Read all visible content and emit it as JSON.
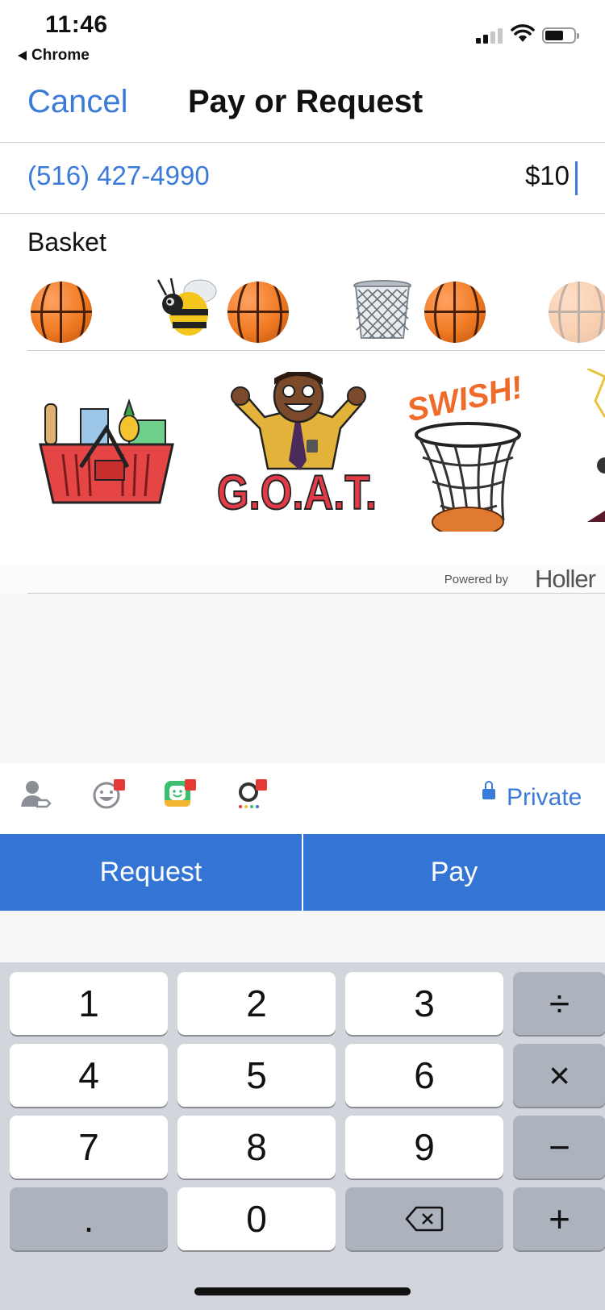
{
  "status_bar": {
    "time": "11:46",
    "back_app": "Chrome"
  },
  "nav": {
    "cancel_label": "Cancel",
    "title": "Pay or Request"
  },
  "recipient": {
    "phone": "(516) 427-4990"
  },
  "amount": "$10",
  "note": {
    "text": "Basket"
  },
  "emoji_suggestions": [
    "basketball-icon",
    "bee-icon",
    "basketball-icon",
    "wastebasket-icon",
    "basketball-icon",
    "basketball-icon"
  ],
  "gifs": [
    {
      "name": "grocery-basket-sticker"
    },
    {
      "name": "goat-sticker",
      "text": "G.O.A.T."
    },
    {
      "name": "swish-sticker",
      "text": "SWISH!"
    }
  ],
  "powered_by": {
    "label": "Powered by",
    "brand": "Holler"
  },
  "toolbar": {
    "privacy_label": "Private"
  },
  "actions": {
    "request_label": "Request",
    "pay_label": "Pay"
  },
  "keyboard": {
    "rows": [
      [
        "1",
        "2",
        "3",
        "÷"
      ],
      [
        "4",
        "5",
        "6",
        "×"
      ],
      [
        "7",
        "8",
        "9",
        "−"
      ],
      [
        ".",
        "0",
        "⌫",
        "+"
      ]
    ]
  },
  "colors": {
    "accent": "#3b7bd8",
    "button": "#3474d4",
    "badge": "#e53935"
  }
}
